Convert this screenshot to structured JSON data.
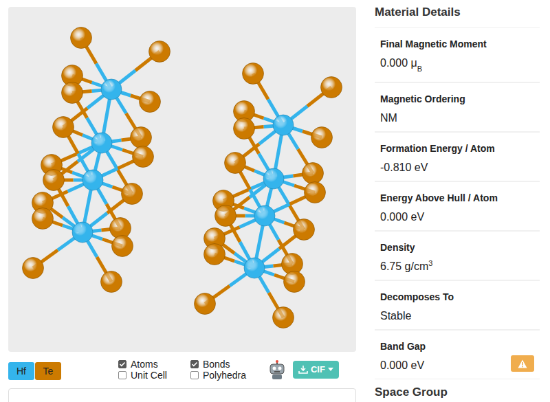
{
  "viewer": {
    "legend": [
      {
        "label": "Hf",
        "color": "#34b4ec"
      },
      {
        "label": "Te",
        "color": "#cc7a00"
      }
    ],
    "toggles": [
      {
        "label": "Atoms",
        "checked": true
      },
      {
        "label": "Unit Cell",
        "checked": false
      },
      {
        "label": "Bonds",
        "checked": true
      },
      {
        "label": "Polyhedra",
        "checked": false
      }
    ],
    "cif_button": "CIF"
  },
  "details": {
    "title": "Material Details",
    "rows": [
      {
        "label": "Final Magnetic Moment",
        "value": "0.000 μ",
        "sub": "B",
        "sup": "",
        "warning": false
      },
      {
        "label": "Magnetic Ordering",
        "value": "NM",
        "sub": "",
        "sup": "",
        "warning": false
      },
      {
        "label": "Formation Energy / Atom",
        "value": "-0.810 eV",
        "sub": "",
        "sup": "",
        "warning": false
      },
      {
        "label": "Energy Above Hull / Atom",
        "value": "0.000 eV",
        "sub": "",
        "sup": "",
        "warning": false
      },
      {
        "label": "Density",
        "value": "6.75 g/cm",
        "sub": "",
        "sup": "3",
        "warning": false
      },
      {
        "label": "Decomposes To",
        "value": "Stable",
        "sub": "",
        "sup": "",
        "warning": false
      },
      {
        "label": "Band Gap",
        "value": "0.000 eV",
        "sub": "",
        "sup": "",
        "warning": true
      }
    ]
  },
  "next_section": {
    "title": "Space Group"
  }
}
